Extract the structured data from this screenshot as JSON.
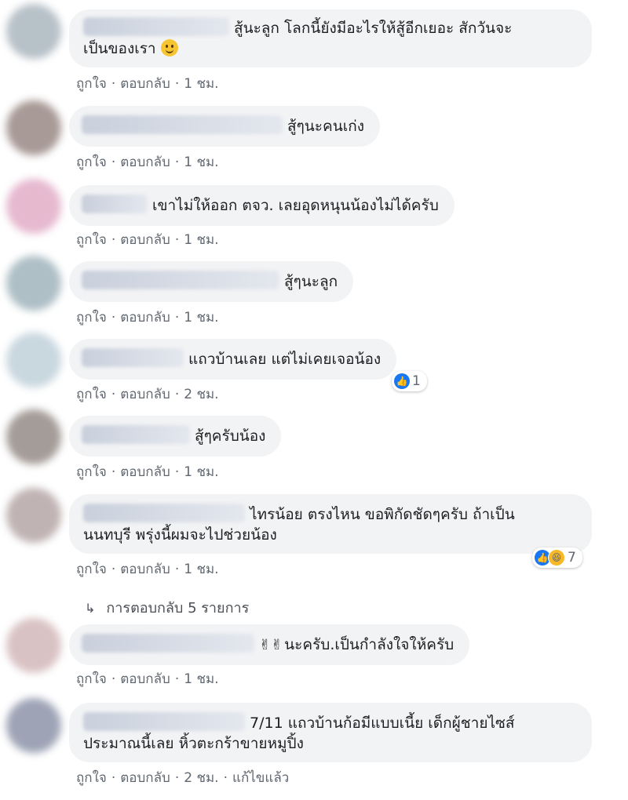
{
  "actions": {
    "like": "ถูกใจ",
    "reply": "ตอบกลับ",
    "edited": "แก้ไขแล้ว",
    "sep": "·"
  },
  "comments": [
    {
      "text_1": "สู้นะลูก โลกนี้ยังมีอะไรให้สู้อีกเยอะ สักวันจะ",
      "text_2": "เป็นของเรา",
      "time": "1 ชม."
    },
    {
      "text": "สู้ๆนะคนเก่ง",
      "time": "1 ชม."
    },
    {
      "text": "เขาไม่ให้ออก ตจว. เลยอุดหนุนน้องไม่ได้ครับ",
      "time": "1 ชม."
    },
    {
      "text": "สู้ๆนะลูก",
      "time": "1 ชม."
    },
    {
      "text": "แถวบ้านเลย แต่ไม่เคยเจอน้อง",
      "time": "2 ชม.",
      "reaction_count": "1"
    },
    {
      "text": "สู้ๆครับน้อง",
      "time": "1 ชม."
    },
    {
      "text_1": "ไทรน้อย ตรงไหน ขอพิกัดชัดๆครับ ถ้าเป็น",
      "text_2": "นนทบุรี พรุ่งนี้ผมจะไปช่วยน้อง",
      "time": "1 ชม.",
      "reaction_count": "7"
    },
    {
      "emoji": "✌✌",
      "text": "นะครับ.เป็นกำลังใจให้ครับ",
      "time": "1 ชม."
    },
    {
      "text_1": "7/11 แถวบ้านก้อมีแบบเนี้ย เด็กผู้ชายไซส์",
      "text_2": "ประมาณนี้เลย หิ้วตะกร้าขายหมูปิ้ง",
      "time": "2 ชม."
    }
  ],
  "replies_link": "การตอบกลับ 5 รายการ",
  "avatar_colors": [
    "#b7c1c8",
    "#a89a96",
    "#e6b9cf",
    "#aebfc6",
    "#c9d7df",
    "#a49c98",
    "#c0b3b4",
    "#d9c2c4",
    "#9ea4b6"
  ]
}
